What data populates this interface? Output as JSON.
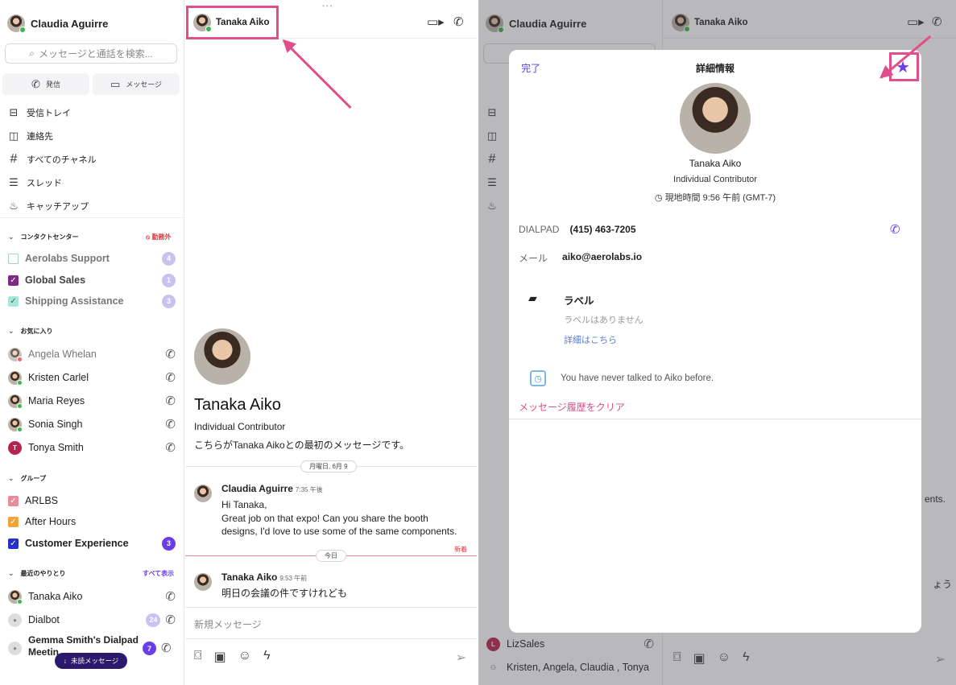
{
  "user": {
    "name": "Claudia  Aguirre"
  },
  "search": {
    "placeholder": "メッセージと通話を検索..."
  },
  "quick": {
    "call": "発信",
    "message": "メッセージ"
  },
  "nav": [
    {
      "icon": "inbox-icon",
      "label": "受信トレイ"
    },
    {
      "icon": "contacts-icon",
      "label": "連絡先"
    },
    {
      "icon": "hash-icon",
      "label": "すべてのチャネル"
    },
    {
      "icon": "threads-icon",
      "label": "スレッド"
    },
    {
      "icon": "flame-icon",
      "label": "キャッチアップ"
    }
  ],
  "contact_center": {
    "title": "コンタクトセンター",
    "status": "勤務外",
    "items": [
      {
        "label": "Aerolabs Support",
        "count": "4",
        "color": "#ffffff"
      },
      {
        "label": "Global Sales",
        "count": "1",
        "color": "#7d2a86"
      },
      {
        "label": "Shipping Assistance",
        "count": "3",
        "color": "#a8e6dc"
      }
    ]
  },
  "favorites": {
    "title": "お気に入り",
    "items": [
      {
        "label": "Angela Whelan"
      },
      {
        "label": "Kristen Carlel"
      },
      {
        "label": "Maria Reyes"
      },
      {
        "label": "Sonia  Singh"
      },
      {
        "label": "Tonya Smith",
        "initial": "T"
      }
    ]
  },
  "groups": {
    "title": "グループ",
    "items": [
      {
        "label": "ARLBS",
        "color": "#e88c9b"
      },
      {
        "label": "After Hours",
        "color": "#f0a43a"
      },
      {
        "label": "Customer Experience",
        "count": "3",
        "color": "#2731c9"
      }
    ]
  },
  "recents": {
    "title": "最近のやりとり",
    "show_all": "すべて表示",
    "items": [
      {
        "label": "Tanaka Aiko"
      },
      {
        "label": "Dialbot",
        "count": "24"
      },
      {
        "label": "Gemma Smith's Dialpad Meetin",
        "count": "7"
      }
    ]
  },
  "unread_button": "未読メッセージ",
  "chat": {
    "contact": "Tanaka Aiko",
    "intro_name": "Tanaka Aiko",
    "intro_role": "Individual Contributor",
    "intro_text": "こちらがTanaka Aikoとの最初のメッセージです。",
    "date_pill": "月曜日, 6月 9",
    "today_pill": "今日",
    "new_label": "新着",
    "messages": [
      {
        "author": "Claudia  Aguirre",
        "time": "7:35 午後",
        "lines": [
          "Hi Tanaka,",
          "Great job on that expo! Can you share the booth",
          "designs, I'd love to use some of the same components."
        ]
      },
      {
        "author": "Tanaka Aiko",
        "time": "9:53 午前",
        "lines": [
          "明日の会議の件ですけれども"
        ]
      }
    ],
    "compose_placeholder": "新規メッセージ"
  },
  "right": {
    "user": "Claudia  Aguirre",
    "contact": "Tanaka Aiko",
    "bg_last": "LizSales",
    "bg_group": "Kristen, Angela, Claudia , Tonya",
    "bg_partial_1": "ents.",
    "bg_partial_2": "ょう"
  },
  "details": {
    "done": "完了",
    "title": "詳細情報",
    "name": "Tanaka Aiko",
    "role": "Individual Contributor",
    "local_time": "現地時間 9:56 午前 (GMT-7)",
    "dialpad_label": "DIALPAD",
    "dialpad_value": "(415) 463-7205",
    "email_label": "メール",
    "email_value": "aiko@aerolabs.io",
    "labels_title": "ラベル",
    "labels_empty": "ラベルはありません",
    "labels_link": "詳細はこちら",
    "never_talked": "You have never talked to Aiko before.",
    "clear_history": "メッセージ履歴をクリア"
  },
  "colors": {
    "accent": "#6a3ee6",
    "highlight": "#e04e8c",
    "danger": "#e0383f"
  }
}
